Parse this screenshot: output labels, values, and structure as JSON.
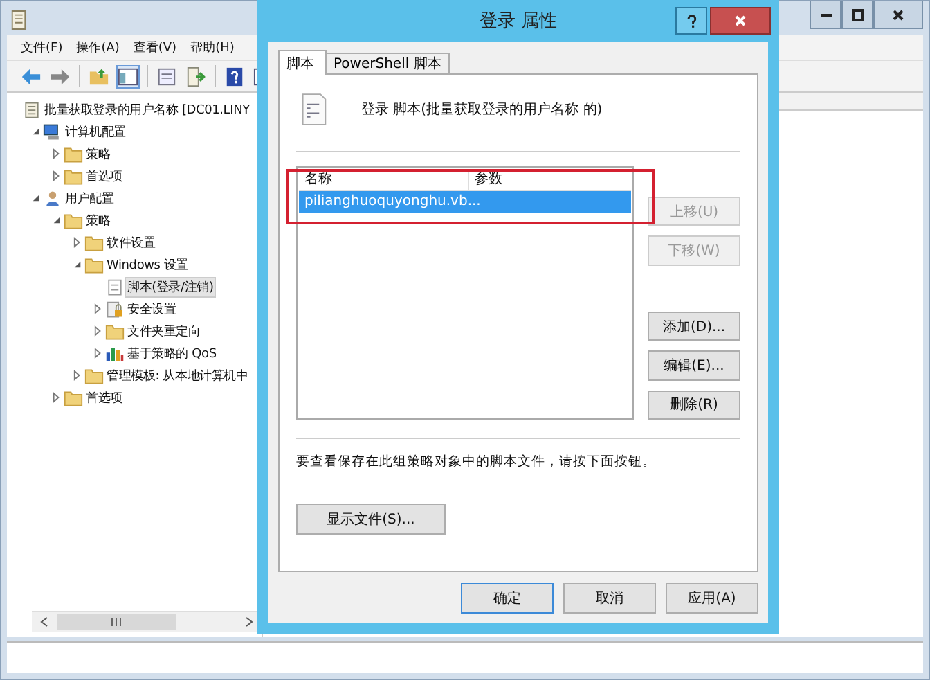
{
  "main_window": {
    "menu": [
      "文件(F)",
      "操作(A)",
      "查看(V)",
      "帮助(H)"
    ],
    "tree": [
      {
        "label": "批量获取登录的用户名称 [DC01.LINY",
        "kind": "root",
        "selected": false,
        "children": [
          {
            "label": "计算机配置",
            "kind": "computer",
            "expanded": true,
            "selected": false,
            "children": [
              {
                "label": "策略",
                "kind": "folder",
                "expanded": false,
                "selected": false
              },
              {
                "label": "首选项",
                "kind": "folder",
                "expanded": false,
                "selected": false
              }
            ]
          },
          {
            "label": "用户配置",
            "kind": "user",
            "expanded": true,
            "selected": false,
            "children": [
              {
                "label": "策略",
                "kind": "folder",
                "expanded": true,
                "selected": false,
                "children": [
                  {
                    "label": "软件设置",
                    "kind": "folder",
                    "expanded": false,
                    "selected": false
                  },
                  {
                    "label": "Windows 设置",
                    "kind": "folder",
                    "expanded": true,
                    "selected": false,
                    "children": [
                      {
                        "label": "脚本(登录/注销)",
                        "kind": "script",
                        "selected": true
                      },
                      {
                        "label": "安全设置",
                        "kind": "lock",
                        "expanded": false,
                        "selected": false
                      },
                      {
                        "label": "文件夹重定向",
                        "kind": "folder",
                        "expanded": false,
                        "selected": false
                      },
                      {
                        "label": "基于策略的 QoS",
                        "kind": "chart",
                        "expanded": false,
                        "selected": false
                      }
                    ]
                  },
                  {
                    "label": "管理模板: 从本地计算机中",
                    "kind": "folder",
                    "expanded": false,
                    "selected": false
                  }
                ]
              },
              {
                "label": "首选项",
                "kind": "folder",
                "expanded": false,
                "selected": false
              }
            ]
          }
        ]
      }
    ]
  },
  "dialog": {
    "title": "登录 属性",
    "tabs": [
      {
        "label": "脚本",
        "selected": true
      },
      {
        "label": "PowerShell 脚本",
        "selected": false
      }
    ],
    "heading": "登录 脚本(批量获取登录的用户名称 的)",
    "columns": [
      "名称",
      "参数"
    ],
    "rows": [
      {
        "name": "pilianghuoquyonghu.vb...",
        "selected": true
      }
    ],
    "side_buttons": [
      {
        "label": "上移(U)",
        "disabled": true
      },
      {
        "label": "下移(W)",
        "disabled": true
      },
      {
        "label": "添加(D)...",
        "disabled": false
      },
      {
        "label": "编辑(E)...",
        "disabled": false
      },
      {
        "label": "删除(R)",
        "disabled": false
      }
    ],
    "hint": "要查看保存在此组策略对象中的脚本文件，请按下面按钮。",
    "show_files_button": "显示文件(S)...",
    "footer_buttons": [
      {
        "label": "确定",
        "default": true
      },
      {
        "label": "取消",
        "default": false
      },
      {
        "label": "应用(A)",
        "default": false
      }
    ]
  }
}
